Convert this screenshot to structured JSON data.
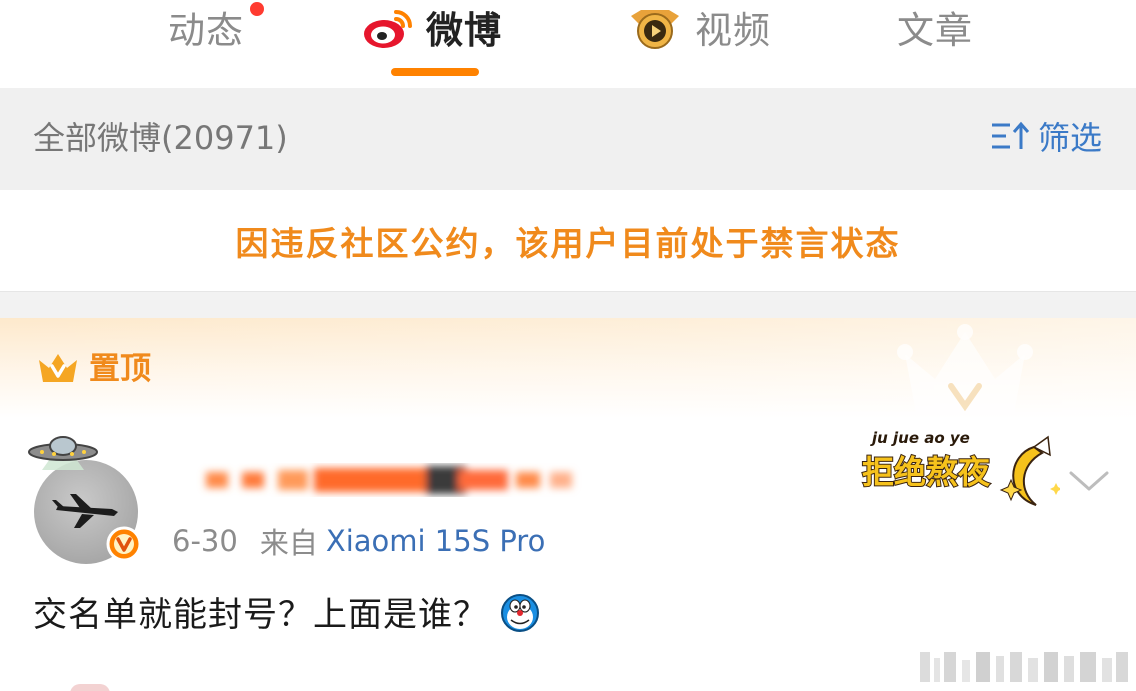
{
  "tabs": [
    {
      "label": "动态",
      "has_dot": true,
      "active": false
    },
    {
      "label": "微博",
      "active": true
    },
    {
      "label": "视频",
      "active": false
    },
    {
      "label": "文章",
      "active": false
    }
  ],
  "filter": {
    "title": "全部微博(20971)",
    "button_label": "筛选"
  },
  "notice": {
    "text": "因违反社区公约，该用户目前处于禁言状态"
  },
  "post": {
    "pinned_label": "置顶",
    "date": "6-30",
    "source_prefix": "来自",
    "device": "Xiaomi 15S Pro",
    "text": "交名单就能封号？上面是谁？",
    "sticker_text": "拒绝熬夜",
    "sticker_subtext": "ju jue ao ye"
  },
  "colors": {
    "accent": "#ff8200",
    "notice": "#f08a1c",
    "link": "#3b6fb5",
    "filter_link": "#3b7ac7",
    "red_dot": "#ff3b30"
  },
  "icons": {
    "weibo_tab": "weibo-logo-icon",
    "video_tab": "video-badge-icon",
    "filter": "sort-filter-icon",
    "pinned": "crown-icon",
    "avatar_decoration": "ufo-icon",
    "verified": "verified-v-icon",
    "more": "chevron-down-icon",
    "emoji": "doraemon-emoji-icon"
  }
}
